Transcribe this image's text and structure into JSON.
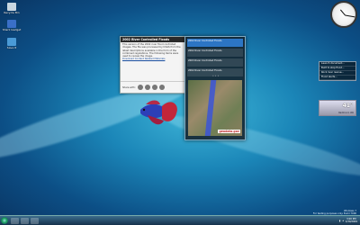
{
  "desktop": {
    "icons": [
      {
        "label": "Recycle Bin",
        "color": "#c9d6e0"
      },
      {
        "label": "Shark Gadget",
        "color": "#3a6fc8"
      },
      {
        "label": "Save It",
        "color": "#4a9ad6"
      }
    ]
  },
  "flyout": {
    "title": "2002 River Controlled Floods",
    "body": "This version of the 2002 river flood controlled images. The file was processed by USGS from the latest descriptions available in the form of the combined regulations. The following items were used to review the image.",
    "link": "Download Content Related Materials",
    "share_label": "Share with:"
  },
  "feed": {
    "items": [
      "2002 River Controlled Floods",
      "2002 River Controlled Floods",
      "2003 River Controlled Floods",
      "2002 River Controlled Floods"
    ],
    "pager": "• • •",
    "map_badge": "geodata.gov"
  },
  "side_gadget": {
    "rows": [
      "Launch document...",
      "Built to stop flood...",
      "Rock river rescue...",
      "Flood alerts..."
    ]
  },
  "weather": {
    "temp": "41°",
    "location": "Redmond, WA"
  },
  "watermark": {
    "line1": "Windows 7",
    "line2": "For testing purposes only. Build 7000"
  },
  "tray": {
    "time": "3:00 PM",
    "date": "1/30/2009"
  }
}
